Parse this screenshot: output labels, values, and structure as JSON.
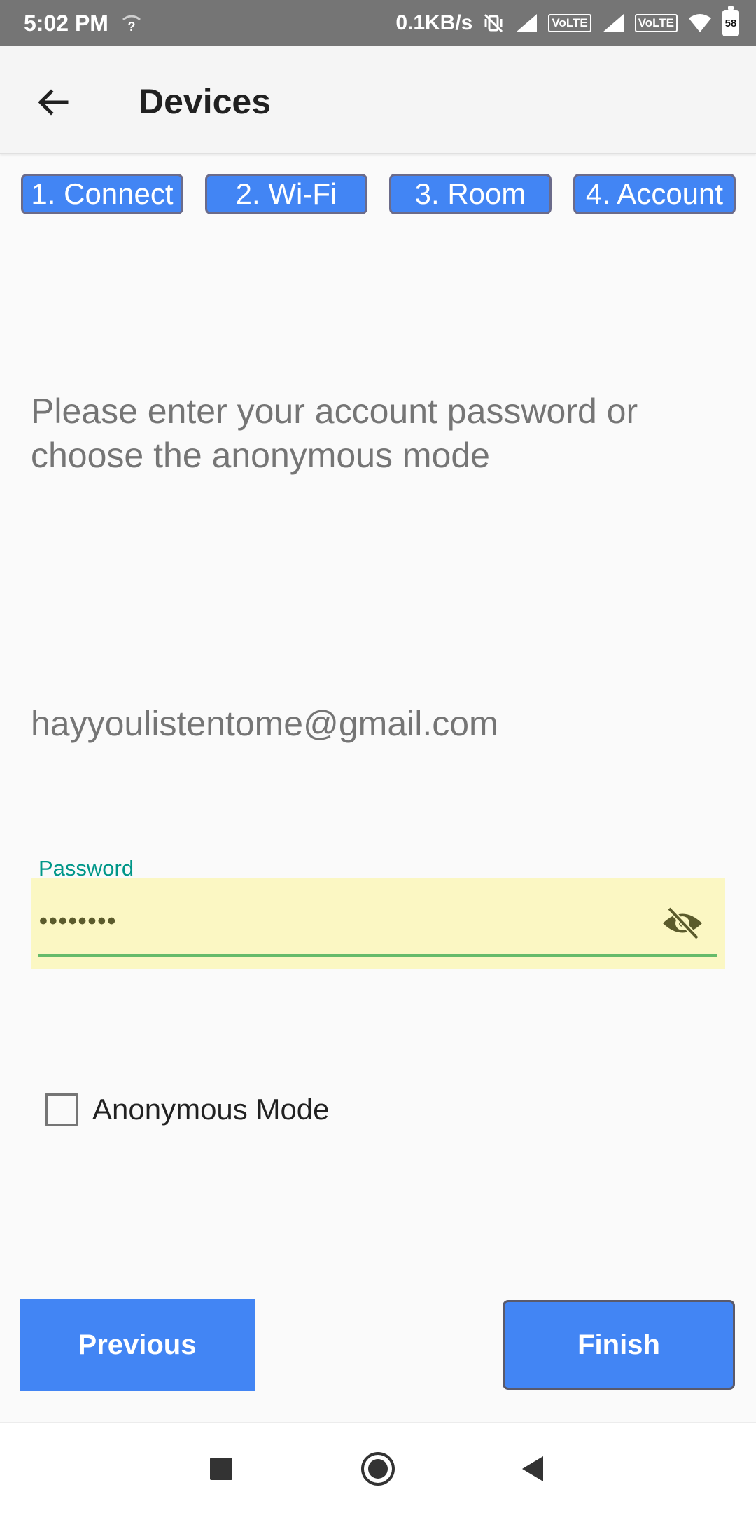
{
  "status_bar": {
    "time": "5:02 PM",
    "net_speed": "0.1KB/s",
    "volte_label": "VoLTE",
    "battery_level": "58",
    "icons": [
      "unknown-wifi-icon",
      "mute-vibrate-icon",
      "signal-icon",
      "signal-icon",
      "wifi-icon",
      "battery-icon"
    ]
  },
  "app_bar": {
    "back_icon": "arrow-back-icon",
    "title": "Devices"
  },
  "steps": [
    "1. Connect",
    "2. Wi-Fi",
    "3. Room",
    "4. Account"
  ],
  "instruction": "Please enter your account password or choose the anonymous mode",
  "email": "hayyoulistentome@gmail.com",
  "password": {
    "label": "Password",
    "value_masked": "••••••••",
    "toggle_icon": "eye-off-icon"
  },
  "anonymous_mode": {
    "label": "Anonymous Mode",
    "checked": false
  },
  "buttons": {
    "previous": "Previous",
    "finish": "Finish"
  },
  "nav_bar": {
    "icons": [
      "recents-square-icon",
      "home-circle-icon",
      "back-triangle-icon"
    ]
  },
  "colors": {
    "accent": "#4285f4",
    "label_teal": "#009688",
    "field_bg": "#fbf7c3",
    "underline": "#66bb6a"
  }
}
